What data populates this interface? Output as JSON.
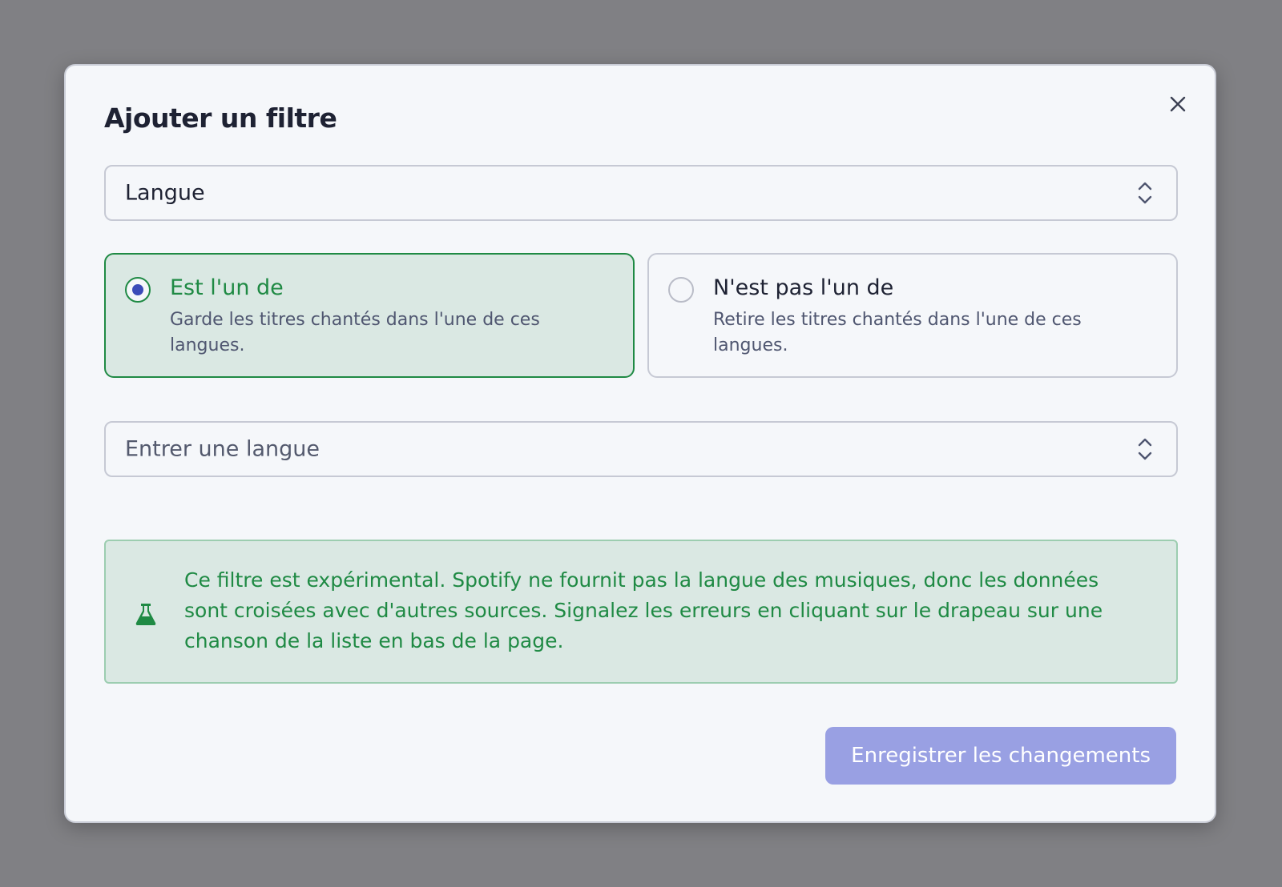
{
  "dialog": {
    "title": "Ajouter un filtre",
    "close_icon": "close-icon"
  },
  "filter_type_select": {
    "value": "Langue",
    "icon": "chevron-up-down-icon"
  },
  "match_options": [
    {
      "label": "Est l'un de",
      "description": "Garde les titres chantés dans l'une de ces langues.",
      "selected": true
    },
    {
      "label": "N'est pas l'un de",
      "description": "Retire les titres chantés dans l'une de ces langues.",
      "selected": false
    }
  ],
  "language_select": {
    "placeholder": "Entrer une langue",
    "icon": "chevron-up-down-icon"
  },
  "info_box": {
    "icon": "flask-icon",
    "text": "Ce filtre est expérimental. Spotify ne fournit pas la langue des musiques, donc les données sont croisées avec d'autres sources. Signalez les erreurs en cliquant sur le drapeau sur une chanson de la liste en bas de la page."
  },
  "save_button": {
    "label": "Enregistrer les changements"
  },
  "colors": {
    "accent_green": "#1f8a44",
    "selected_bg": "#dae8e3",
    "button_bg": "#99a0e3",
    "radio_dot": "#3b4bb8",
    "overlay": "#808084"
  }
}
